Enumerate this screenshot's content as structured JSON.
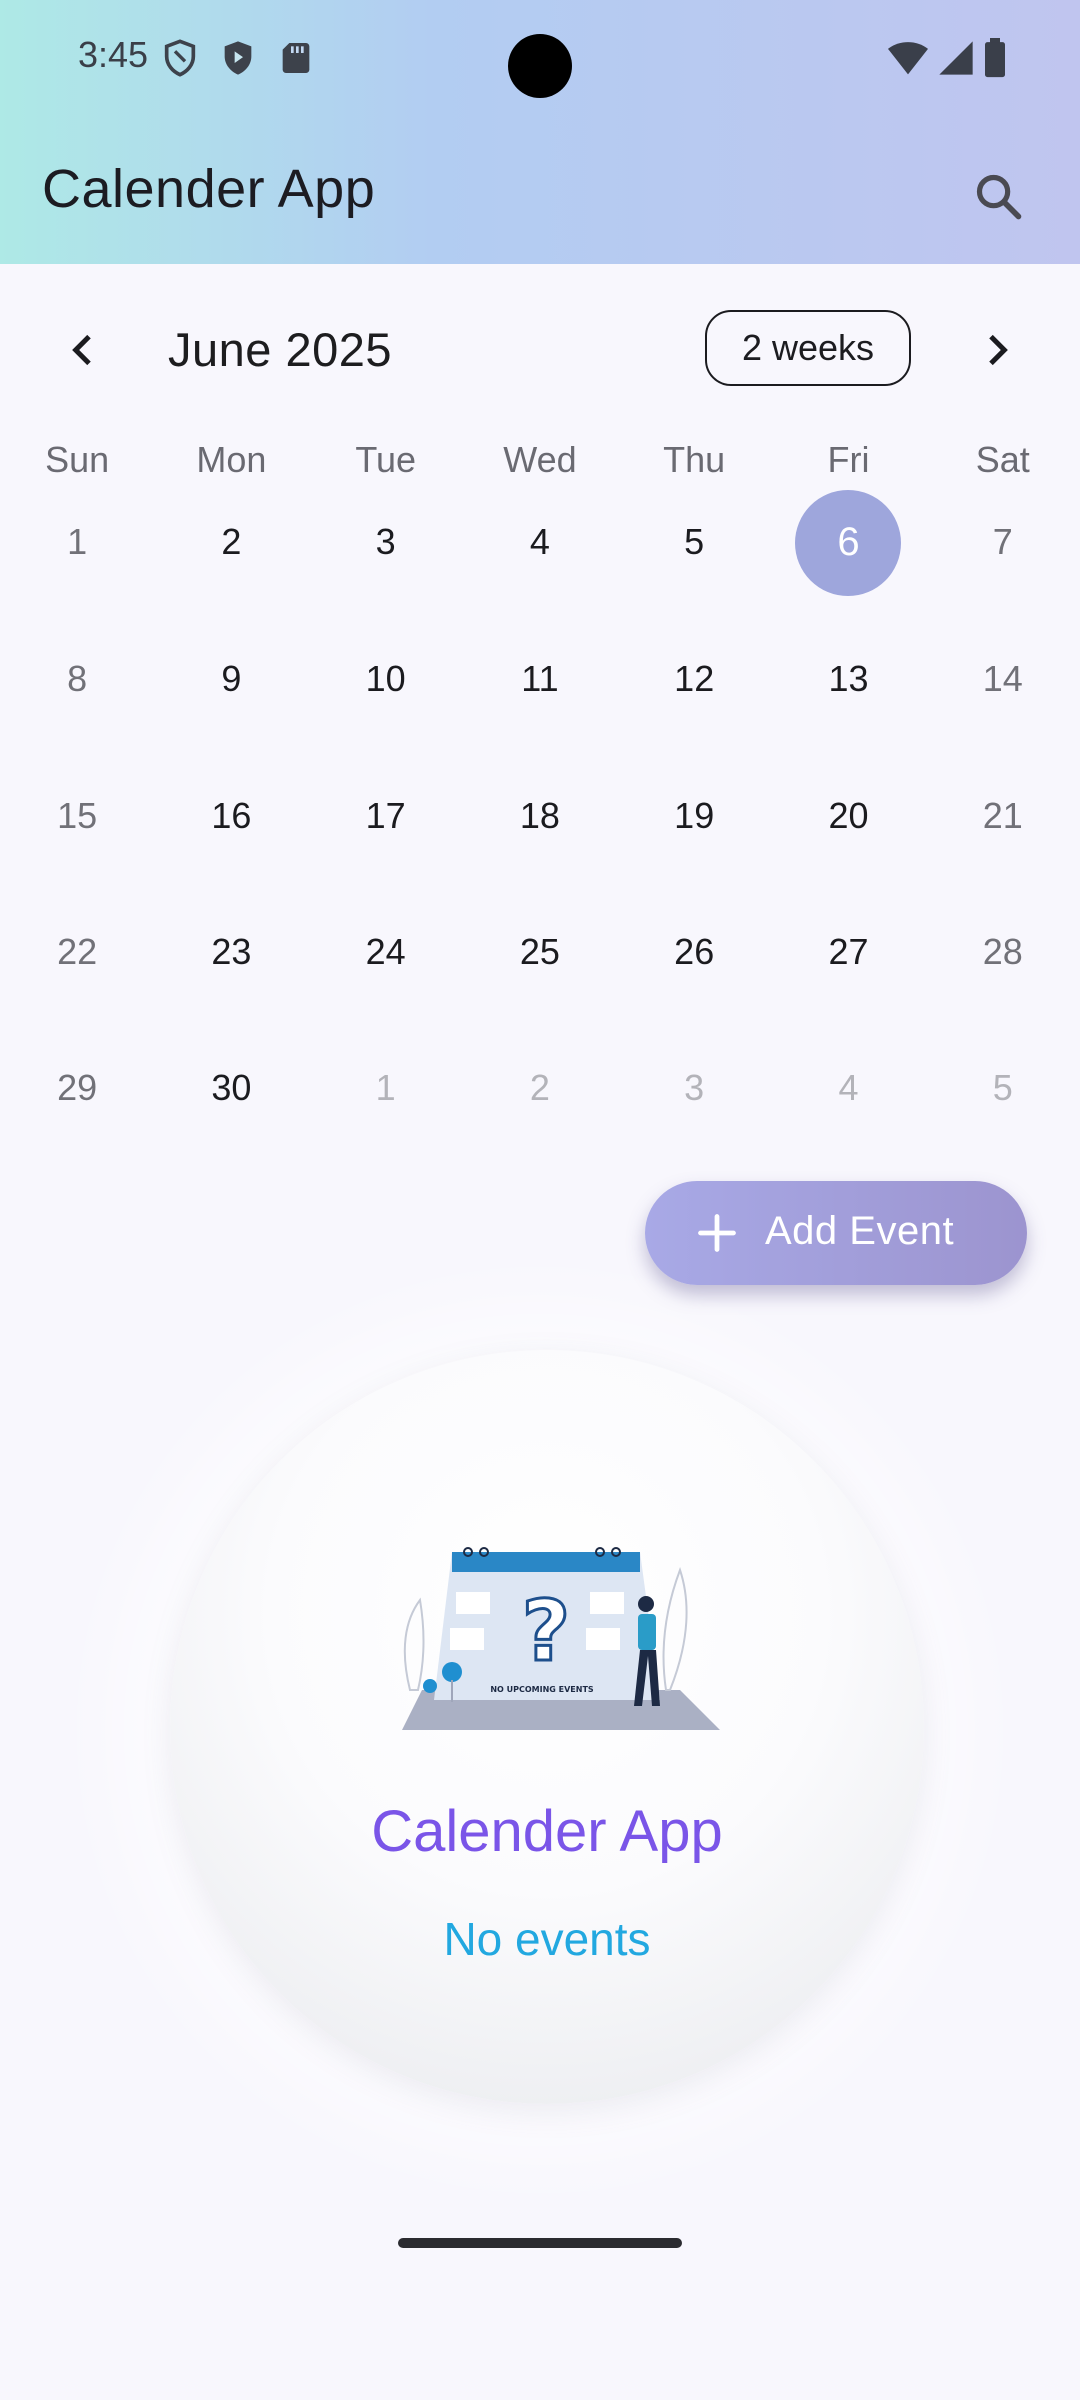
{
  "status_bar": {
    "time": "3:45"
  },
  "app_bar": {
    "title": "Calender App"
  },
  "calendar": {
    "month_title": "June 2025",
    "format_button": "2 weeks",
    "weekdays": [
      "Sun",
      "Mon",
      "Tue",
      "Wed",
      "Thu",
      "Fri",
      "Sat"
    ],
    "weeks": [
      [
        "1",
        "2",
        "3",
        "4",
        "5",
        "6",
        "7"
      ],
      [
        "8",
        "9",
        "10",
        "11",
        "12",
        "13",
        "14"
      ],
      [
        "15",
        "16",
        "17",
        "18",
        "19",
        "20",
        "21"
      ],
      [
        "22",
        "23",
        "24",
        "25",
        "26",
        "27",
        "28"
      ],
      [
        "29",
        "30",
        "1",
        "2",
        "3",
        "4",
        "5"
      ]
    ],
    "selected_day": "6"
  },
  "fab": {
    "label": "Add Event"
  },
  "empty_state": {
    "title": "Calender App",
    "subtitle": "No events",
    "illustration_text": "NO UPCOMING EVENTS"
  },
  "colors": {
    "accent_purple": "#7a55e8",
    "accent_blue": "#22a8e0",
    "selected_day_bg": "#9ea6dc",
    "fab_bg": "#a09bd9"
  }
}
